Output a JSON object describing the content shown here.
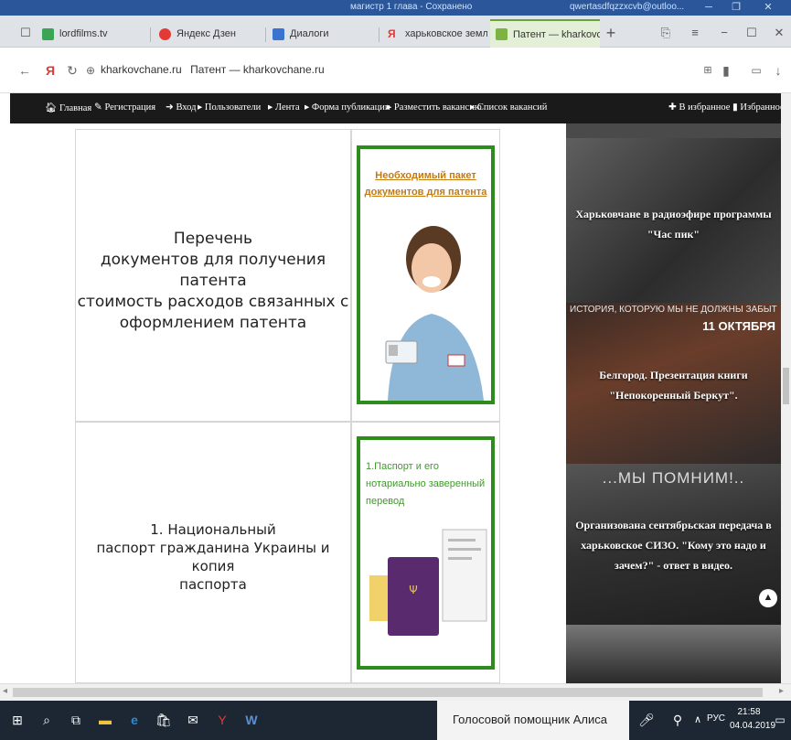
{
  "title_strip": {
    "doc_title": "магистр 1 глава - Сохранено",
    "account": "qwertasdfqzzxcvb@outloo..."
  },
  "tabs": [
    {
      "label": "lordfilms.tv",
      "color": "#3aa655"
    },
    {
      "label": "Яндекс Дзен",
      "color": "#e53935"
    },
    {
      "label": "Диалоги",
      "color": "#3b73d1"
    },
    {
      "label": "харьковское землячест",
      "color": "#e53935"
    },
    {
      "label": "Патент — kharkovch",
      "color": "#7cb342",
      "active": true
    }
  ],
  "address": {
    "domain": "kharkovchane.ru",
    "page_title": "Патент — kharkovchane.ru"
  },
  "site_nav": {
    "items": [
      "Главная",
      "Регистрация",
      "Вход",
      "Пользователи",
      "Лента",
      "Форма публикации",
      "Разместить вакансию",
      "Список вакансий"
    ],
    "right": [
      "В избранное",
      "Избранное"
    ]
  },
  "content": {
    "row1_text": [
      "Перечень",
      "документов для получения патента",
      "стоимость расходов связанных с",
      "оформлением патента"
    ],
    "row1_image_title": [
      "Необходимый пакет",
      "документов для патента"
    ],
    "row2_text": [
      "1. Национальный",
      "паспорт гражданина Украины и копия",
      "паспорта"
    ],
    "row2_image_title": [
      "1.Паспорт и его",
      "нотариально заверенный",
      "перевод"
    ]
  },
  "sidebar": {
    "items": [
      {
        "caption": [
          "Харьковчане в радиоэфире программы",
          "\"Час пик\""
        ]
      },
      {
        "banner": "ИСТОРИЯ, КОТОРУЮ МЫ НЕ ДОЛЖНЫ ЗАБЫТЬ",
        "date": "11 ОКТЯБРЯ",
        "caption": [
          "Белгород. Презентация книги",
          "\"Непокоренный Беркут\"."
        ]
      },
      {
        "banner": "...МЫ ПОМНИМ!..",
        "caption": [
          "Организована сентябрьская передача в",
          "харьковское СИЗО. \"Кому это надо и",
          "зачем?\" - ответ в видео."
        ]
      }
    ]
  },
  "taskbar": {
    "assistant": "Голосовой помощник Алиса",
    "lang": "РУС",
    "time": "21:58",
    "date": "04.04.2019"
  }
}
